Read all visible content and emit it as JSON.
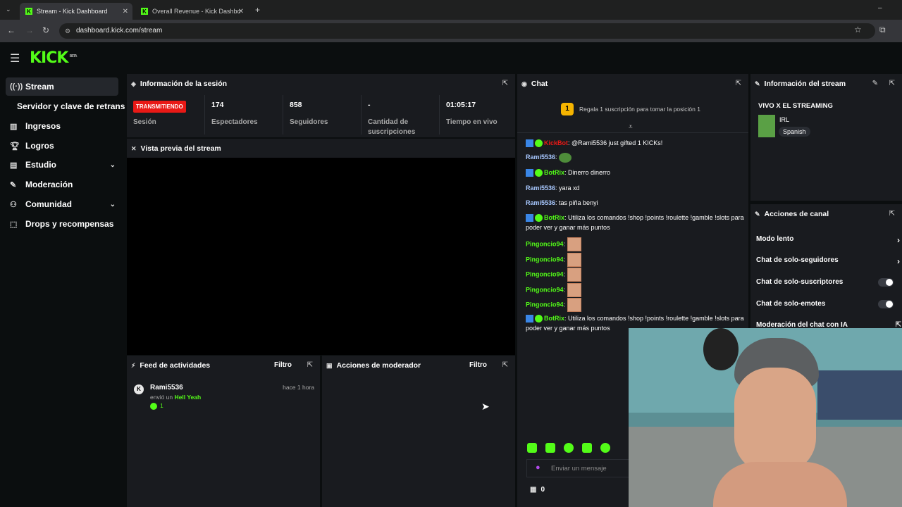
{
  "browser": {
    "tabs": [
      {
        "label": "Stream - Kick Dashboard",
        "active": true
      },
      {
        "label": "Overall Revenue - Kick Dashbo",
        "active": false
      }
    ],
    "url": "dashboard.kick.com/stream"
  },
  "brand": {
    "logo": "KICK",
    "beta": "BETA",
    "accent": "#53fc18"
  },
  "sidebar": {
    "items": [
      {
        "label": "Stream",
        "icon": "broadcast-icon"
      },
      {
        "label": "Servidor y clave de retransm",
        "icon": ""
      },
      {
        "label": "Ingresos",
        "icon": "chart-icon"
      },
      {
        "label": "Logros",
        "icon": "trophy-icon"
      },
      {
        "label": "Estudio",
        "icon": "studio-icon"
      },
      {
        "label": "Moderación",
        "icon": "wrench-icon"
      },
      {
        "label": "Comunidad",
        "icon": "community-icon"
      },
      {
        "label": "Drops y recompensas",
        "icon": "gift-icon"
      }
    ]
  },
  "session": {
    "title": "Información de la sesión",
    "status": "TRANSMITIENDO",
    "status_label": "Sesión",
    "viewers": "174",
    "viewers_label": "Espectadores",
    "followers": "858",
    "followers_label": "Seguidores",
    "subs": "-",
    "subs_label": "Cantidad de suscripciones",
    "uptime": "01:05:17",
    "uptime_label": "Tiempo en vivo"
  },
  "preview": {
    "title": "Vista previa del stream"
  },
  "activity": {
    "title": "Feed de actividades",
    "filter": "Filtro",
    "item": {
      "user": "Rami5536",
      "time": "hace 1 hora",
      "action_prefix": "envió un",
      "action_item": "Hell Yeah",
      "amount": "1"
    }
  },
  "mod_actions": {
    "title": "Acciones de moderador",
    "filter": "Filtro"
  },
  "chat": {
    "title": "Chat",
    "gift_banner": "Regala 1 suscripción para tomar la posición 1",
    "rank": "1",
    "messages": [
      {
        "user": "KickBot",
        "text": ": @Rami5536 just gifted 1 KICKs!",
        "color": "#e91916",
        "badges": true
      },
      {
        "user": "Rami5536",
        "text": ":",
        "color": "#a8c8ff",
        "emote": "pepe"
      },
      {
        "user": "BotRix",
        "text": ": Dinerro dinerro",
        "color": "#53fc18",
        "badges": true
      },
      {
        "user": "Rami5536",
        "text": ": yara xd",
        "color": "#a8c8ff"
      },
      {
        "user": "Rami5536",
        "text": ": tas piña benyi",
        "color": "#a8c8ff"
      },
      {
        "user": "BotRix",
        "text": ": Utiliza los comandos !shop !points !roulette !gamble !slots para poder ver y ganar más puntos",
        "color": "#53fc18",
        "badges": true
      },
      {
        "user": "Pingoncio94",
        "text": ":",
        "color": "#53fc18",
        "emote": "face"
      },
      {
        "user": "Pingoncio94",
        "text": ":",
        "color": "#53fc18",
        "emote": "face"
      },
      {
        "user": "Pingoncio94",
        "text": ":",
        "color": "#53fc18",
        "emote": "face"
      },
      {
        "user": "Pingoncio94",
        "text": ":",
        "color": "#53fc18",
        "emote": "face"
      },
      {
        "user": "Pingoncio94",
        "text": ":",
        "color": "#53fc18",
        "emote": "face"
      },
      {
        "user": "BotRix",
        "text": ": Utiliza los comandos !shop !points !roulette !gamble !slots para poder ver y ganar más puntos",
        "color": "#53fc18",
        "badges": true
      }
    ],
    "input_placeholder": "Enviar un mensaje",
    "points": "0"
  },
  "stream_info": {
    "title": "Información del stream",
    "stream_title": "VIVO X EL STREAMING",
    "category": "IRL",
    "language": "Spanish"
  },
  "channel_actions": {
    "title": "Acciones de canal",
    "items": [
      {
        "label": "Modo lento",
        "type": "chevron"
      },
      {
        "label": "Chat de solo-seguidores",
        "type": "chevron"
      },
      {
        "label": "Chat de solo-suscriptores",
        "type": "toggle"
      },
      {
        "label": "Chat de solo-emotes",
        "type": "toggle"
      },
      {
        "label": "Moderación del chat con IA",
        "type": "popout"
      }
    ]
  }
}
